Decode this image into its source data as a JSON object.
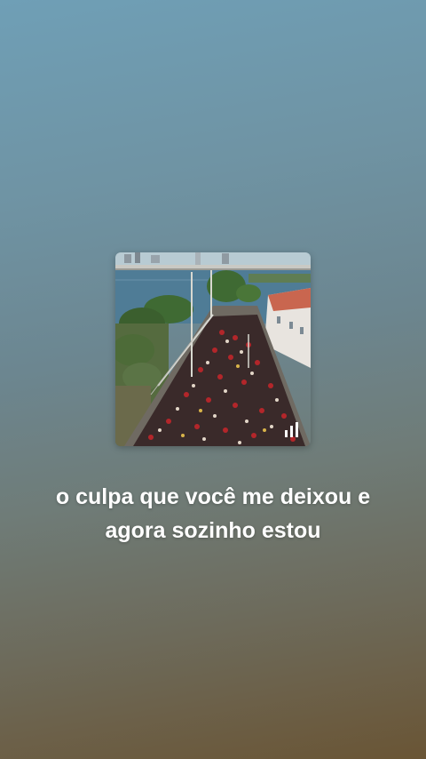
{
  "now_playing": {
    "artwork_icon": "album-artwork",
    "visualizer_icon": "equalizer-bars-icon",
    "lyrics_line": "o culpa que você me deixou e agora sozinho estou"
  }
}
